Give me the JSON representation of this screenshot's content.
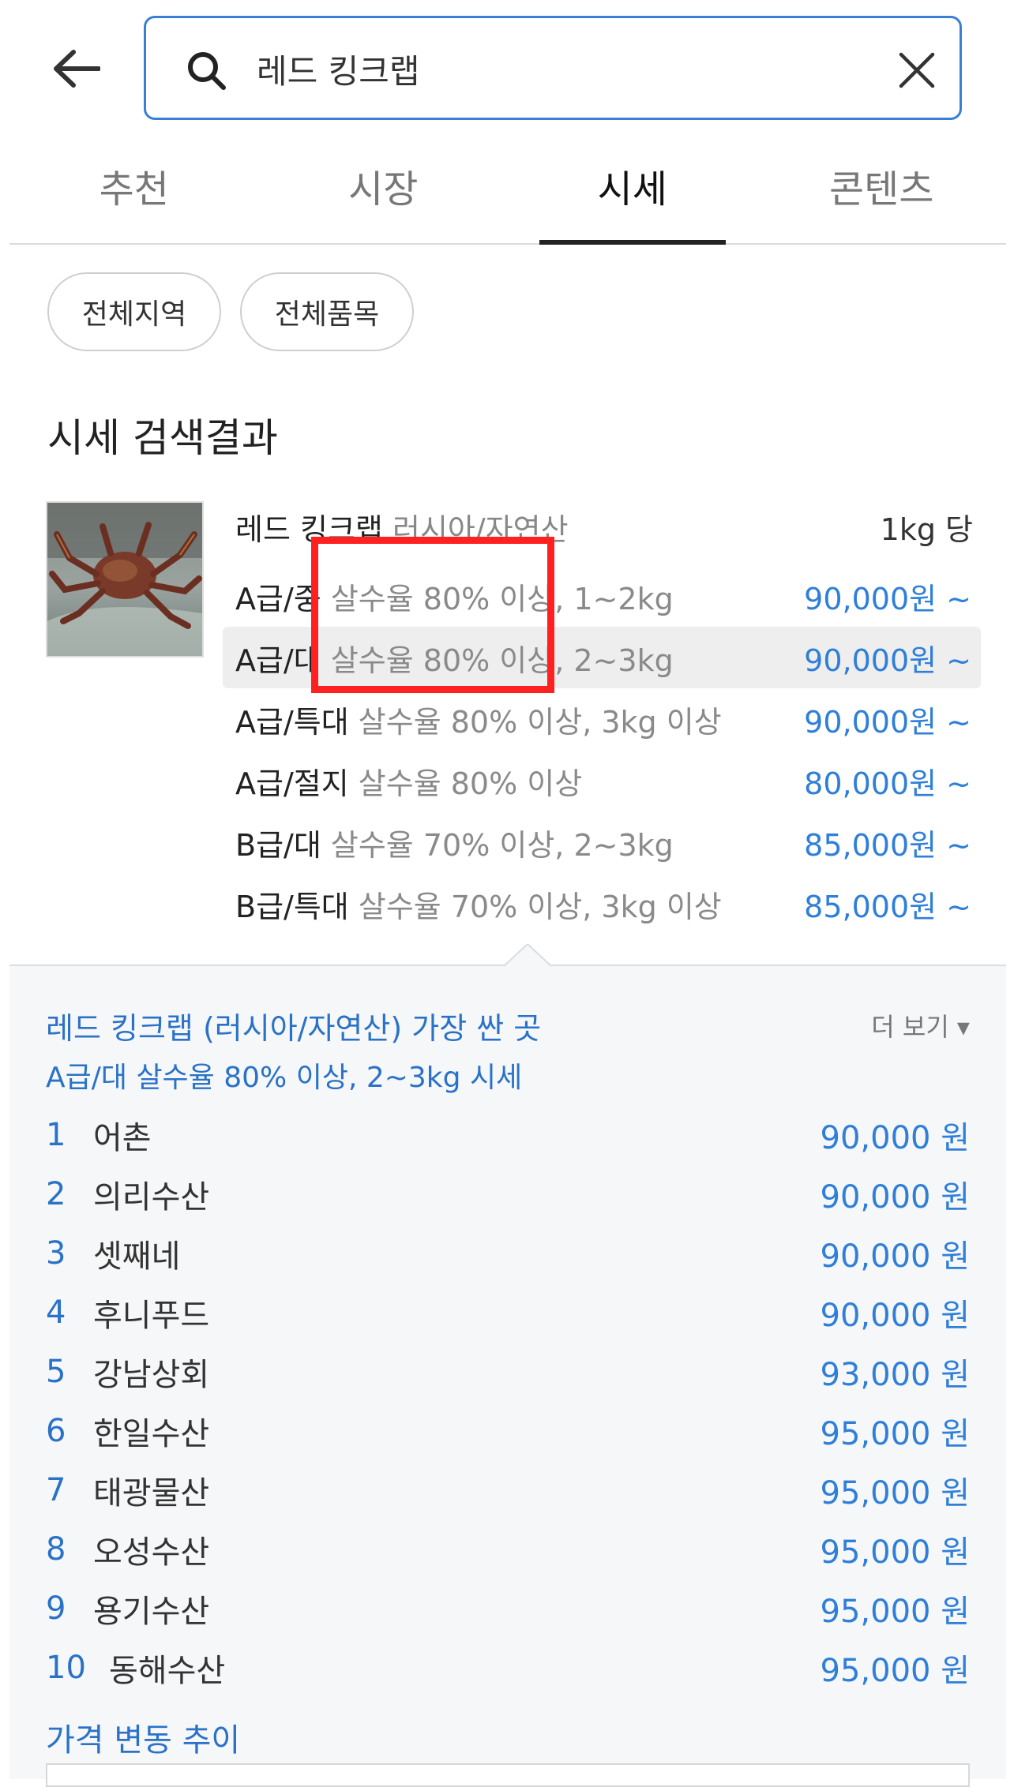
{
  "search": {
    "query": "레드 킹크랩"
  },
  "tabs": [
    {
      "label": "추천"
    },
    {
      "label": "시장"
    },
    {
      "label": "시세"
    },
    {
      "label": "콘텐츠"
    }
  ],
  "filters": {
    "region": "전체지역",
    "item": "전체품목"
  },
  "results": {
    "title": "시세 검색결과",
    "product": {
      "name": "레드 킹크랩",
      "origin": "러시아/자연산",
      "unit": "1kg 당"
    },
    "rows": [
      {
        "grade": "A급/중",
        "desc": "살수율 80% 이상, 1~2kg",
        "price": "90,000원 ~"
      },
      {
        "grade": "A급/대",
        "desc": "살수율 80% 이상, 2~3kg",
        "price": "90,000원 ~"
      },
      {
        "grade": "A급/특대",
        "desc": "살수율 80% 이상, 3kg 이상",
        "price": "90,000원 ~"
      },
      {
        "grade": "A급/절지",
        "desc": "살수율 80% 이상",
        "price": "80,000원 ~"
      },
      {
        "grade": "B급/대",
        "desc": "살수율 70% 이상, 2~3kg",
        "price": "85,000원 ~"
      },
      {
        "grade": "B급/특대",
        "desc": "살수율 70% 이상, 3kg 이상",
        "price": "85,000원 ~"
      }
    ]
  },
  "cheapest": {
    "title": "레드 킹크랩 (러시아/자연산) 가장 싼 곳",
    "subtitle": "A급/대 살수율 80% 이상, 2~3kg 시세",
    "more": "더 보기 ▾",
    "items": [
      {
        "rank": "1",
        "name": "어촌",
        "price": "90,000 원"
      },
      {
        "rank": "2",
        "name": "의리수산",
        "price": "90,000 원"
      },
      {
        "rank": "3",
        "name": "셋째네",
        "price": "90,000 원"
      },
      {
        "rank": "4",
        "name": "후니푸드",
        "price": "90,000 원"
      },
      {
        "rank": "5",
        "name": "강남상회",
        "price": "93,000 원"
      },
      {
        "rank": "6",
        "name": "한일수산",
        "price": "95,000 원"
      },
      {
        "rank": "7",
        "name": "태광물산",
        "price": "95,000 원"
      },
      {
        "rank": "8",
        "name": "오성수산",
        "price": "95,000 원"
      },
      {
        "rank": "9",
        "name": "용기수산",
        "price": "95,000 원"
      },
      {
        "rank": "10",
        "name": "동해수산",
        "price": "95,000 원"
      }
    ]
  },
  "trend": {
    "label": "가격 변동 추이"
  },
  "colors": {
    "accent": "#2f7fd9",
    "search_border": "#3a7fd6",
    "highlight_box": "#ff2020"
  },
  "icons": {
    "back": "arrow-left-icon",
    "search": "search-icon",
    "clear": "close-icon"
  }
}
